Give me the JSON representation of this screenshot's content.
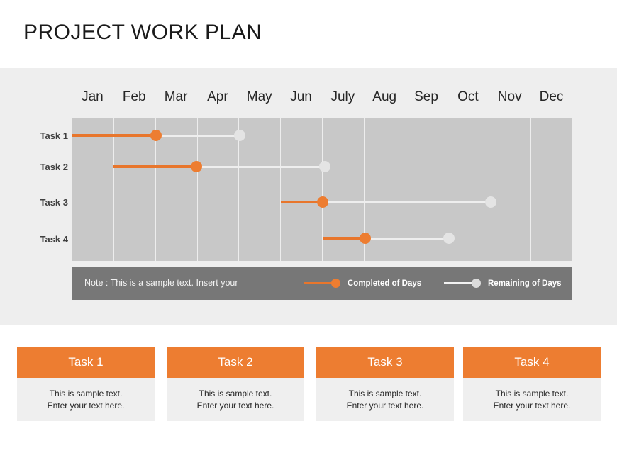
{
  "page": {
    "title": "PROJECT WORK PLAN",
    "accent_color": "#ED7D31",
    "panel_color": "#EEEEEE",
    "plot_color": "#C8C8C8",
    "note_bar_color": "#777777"
  },
  "chart_data": {
    "type": "bar",
    "title": "PROJECT WORK PLAN",
    "xlabel": "",
    "ylabel": "",
    "grid": true,
    "legend_position": "bottom",
    "categories": [
      "Jan",
      "Feb",
      "Mar",
      "Apr",
      "May",
      "Jun",
      "July",
      "Aug",
      "Sep",
      "Oct",
      "Nov",
      "Dec"
    ],
    "x_axis_months": [
      "Jan",
      "Feb",
      "Mar",
      "Apr",
      "May",
      "Jun",
      "July",
      "Aug",
      "Sep",
      "Oct",
      "Nov",
      "Dec"
    ],
    "series": [
      {
        "name": "Completed of Days",
        "color": "#E8762C"
      },
      {
        "name": "Remaining of Days",
        "color": "#E4E4E4"
      }
    ],
    "tasks": [
      {
        "label": "Task 1",
        "start_month": 1.0,
        "completed_end_month": 3.0,
        "remaining_end_month": 5.0,
        "start_pct": 0.0,
        "completed_pct": 16.9,
        "remaining_pct": 33.6
      },
      {
        "label": "Task 2",
        "start_month": 2.0,
        "completed_end_month": 4.0,
        "remaining_end_month": 7.1,
        "start_pct": 8.4,
        "completed_pct": 24.9,
        "remaining_pct": 50.6
      },
      {
        "label": "Task 3",
        "start_month": 6.0,
        "completed_end_month": 7.0,
        "remaining_end_month": 11.0,
        "start_pct": 41.8,
        "completed_pct": 50.1,
        "remaining_pct": 83.7
      },
      {
        "label": "Task 4",
        "start_month": 7.0,
        "completed_end_month": 8.0,
        "remaining_end_month": 10.0,
        "start_pct": 50.1,
        "completed_pct": 58.6,
        "remaining_pct": 75.4
      }
    ]
  },
  "note": {
    "text": "Note : This is a sample text. Insert  your"
  },
  "legend": {
    "completed_label": "Completed of Days",
    "remaining_label": "Remaining of Days"
  },
  "cards": [
    {
      "title": "Task 1",
      "line1": "This is sample text.",
      "line2": "Enter your text here."
    },
    {
      "title": "Task 2",
      "line1": "This is sample text.",
      "line2": "Enter your text here."
    },
    {
      "title": "Task 3",
      "line1": "This is sample text.",
      "line2": "Enter your text here."
    },
    {
      "title": "Task 4",
      "line1": "This is sample text.",
      "line2": "Enter your text here."
    }
  ]
}
